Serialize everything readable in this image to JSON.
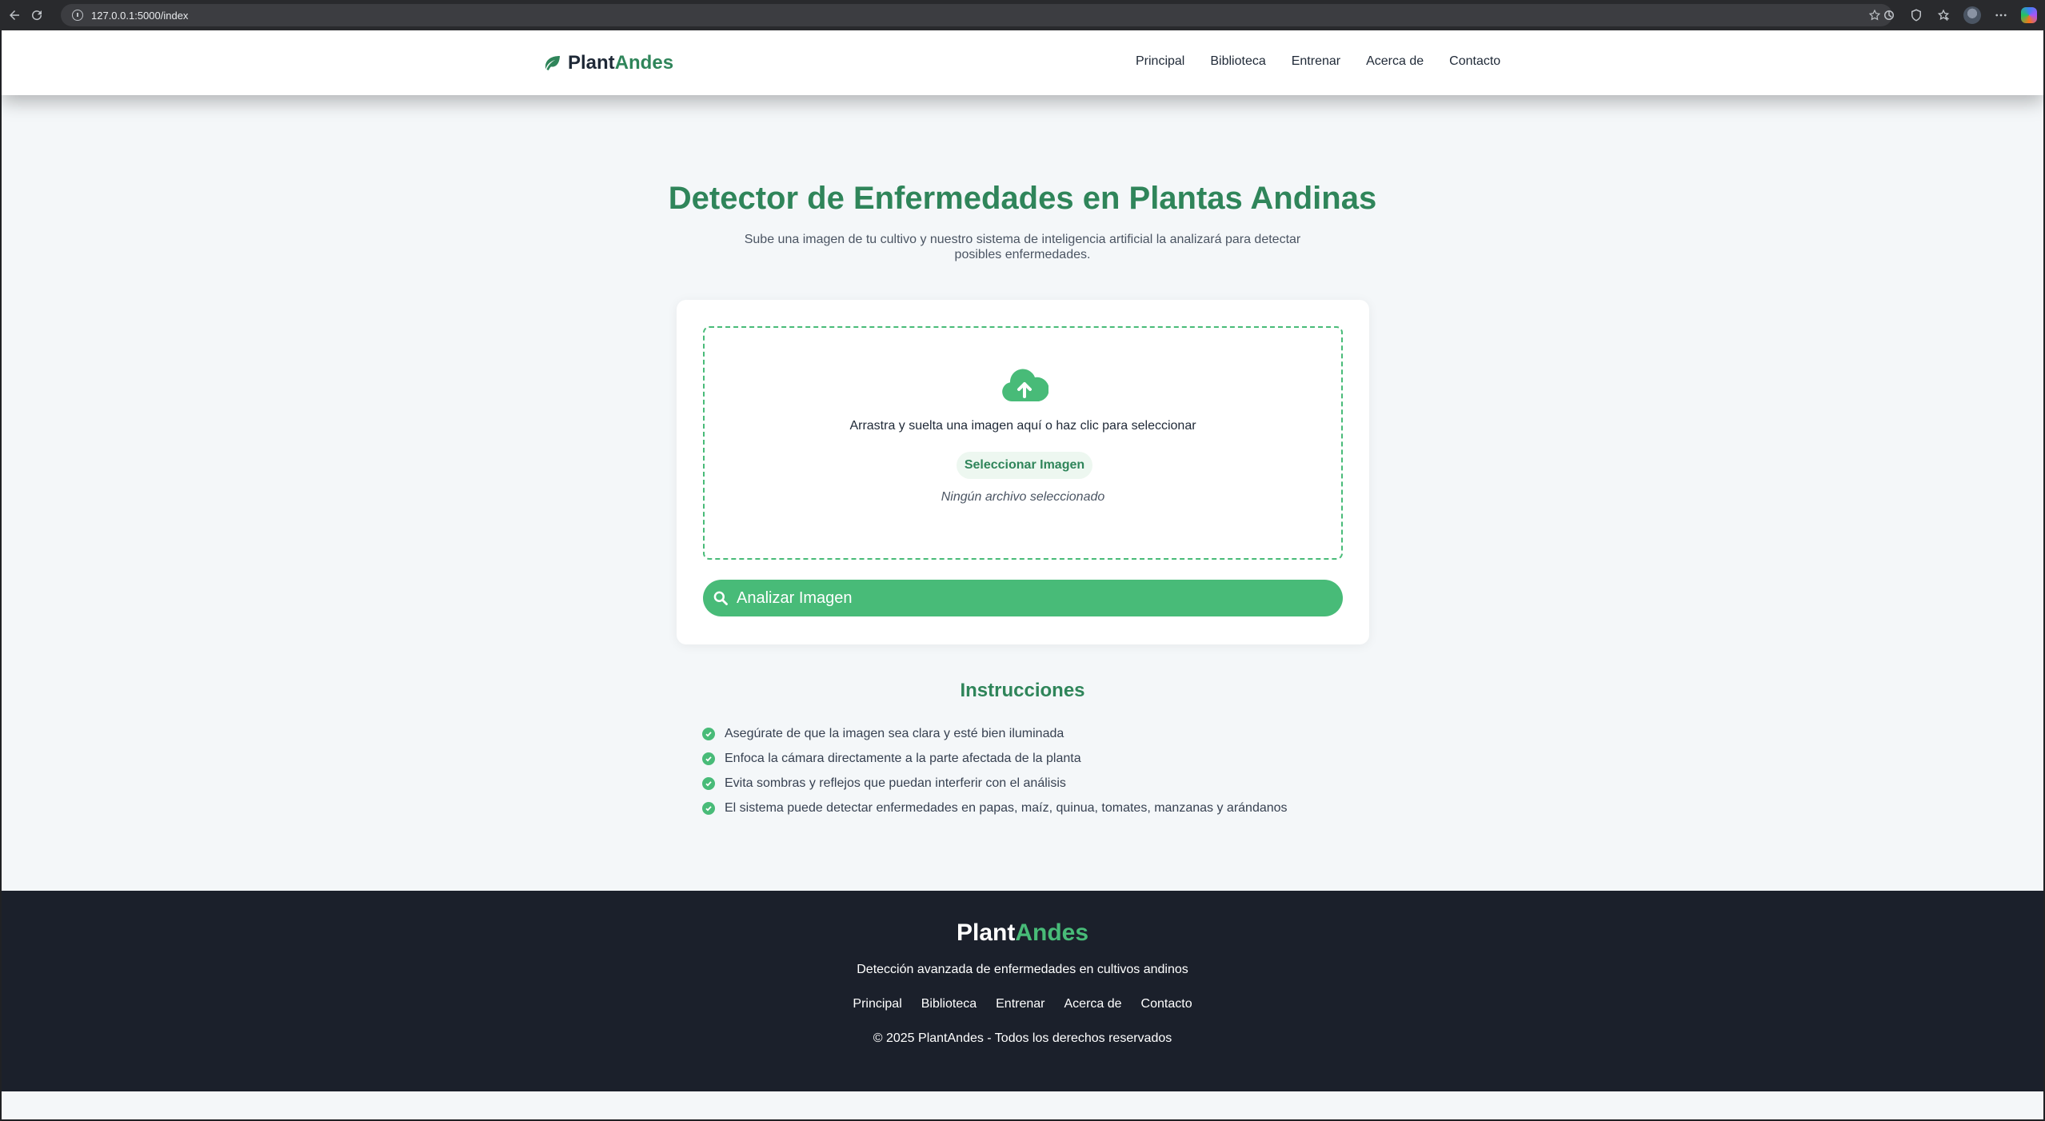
{
  "browser": {
    "url": "127.0.0.1:5000/index"
  },
  "header": {
    "brand_part1": "Plant",
    "brand_part2": "Andes",
    "nav": [
      "Principal",
      "Biblioteca",
      "Entrenar",
      "Acerca de",
      "Contacto"
    ]
  },
  "hero": {
    "title": "Detector de Enfermedades en Plantas Andinas",
    "subtitle": "Sube una imagen de tu cultivo y nuestro sistema de inteligencia artificial la analizará para detectar posibles enfermedades."
  },
  "upload": {
    "drop_text": "Arrastra y suelta una imagen aquí o haz clic para seleccionar",
    "select_label": "Seleccionar Imagen",
    "file_status": "Ningún archivo seleccionado",
    "analyze_label": "Analizar Imagen"
  },
  "instructions": {
    "title": "Instrucciones",
    "items": [
      "Asegúrate de que la imagen sea clara y esté bien iluminada",
      "Enfoca la cámara directamente a la parte afectada de la planta",
      "Evita sombras y reflejos que puedan interferir con el análisis",
      "El sistema puede detectar enfermedades en papas, maíz, quinua, tomates, manzanas y arándanos"
    ]
  },
  "footer": {
    "brand_part1": "Plant",
    "brand_part2": "Andes",
    "tagline": "Detección avanzada de enfermedades en cultivos andinos",
    "nav": [
      "Principal",
      "Biblioteca",
      "Entrenar",
      "Acerca de",
      "Contacto"
    ],
    "copyright": "© 2025 PlantAndes - Todos los derechos reservados"
  },
  "colors": {
    "primary_green": "#2f855a",
    "accent_green": "#48bb78",
    "footer_bg": "#1b202b",
    "page_bg": "#f4f7f9"
  },
  "icons": {
    "brand": "leaf-icon",
    "upload": "cloud-upload-icon",
    "analyze": "search-icon",
    "instruction": "check-circle-icon"
  }
}
